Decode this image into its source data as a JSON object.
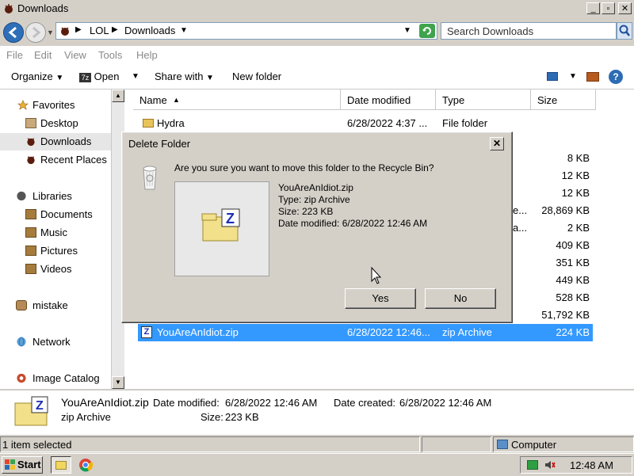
{
  "window": {
    "title": "Downloads"
  },
  "address": {
    "crumbs": [
      "LOL",
      "Downloads"
    ],
    "search_placeholder": "Search Downloads"
  },
  "menu": [
    "File",
    "Edit",
    "View",
    "Tools",
    "Help"
  ],
  "toolbar": {
    "organize": "Organize",
    "open": "Open",
    "share_with": "Share with",
    "new_folder": "New folder"
  },
  "nav": {
    "favorites": "Favorites",
    "desktop": "Desktop",
    "downloads": "Downloads",
    "recent_places": "Recent Places",
    "libraries": "Libraries",
    "documents": "Documents",
    "music": "Music",
    "pictures": "Pictures",
    "videos": "Videos",
    "mistake": "mistake",
    "network": "Network",
    "image_catalog": "Image Catalog"
  },
  "columns": {
    "name": "Name",
    "date": "Date modified",
    "type": "Type",
    "size": "Size"
  },
  "rows": {
    "hydra": {
      "name": "Hydra",
      "date": "6/28/2022 4:37 ...",
      "type": "File folder",
      "size": ""
    },
    "sizes": [
      "8 KB",
      "12 KB",
      "12 KB",
      "28,869 KB",
      "2 KB",
      "409 KB",
      "351 KB",
      "449 KB",
      "528 KB",
      "51,792 KB"
    ],
    "partial_e": "e...",
    "partial_a": "a...",
    "selected": {
      "name": "YouAreAnIdiot.zip",
      "date": "6/28/2022 12:46...",
      "type": "zip Archive",
      "size": "224 KB"
    }
  },
  "details": {
    "name": "YouAreAnIdiot.zip",
    "type": "zip Archive",
    "date_modified_label": "Date modified:",
    "date_modified": "6/28/2022 12:46 AM",
    "date_created_label": "Date created:",
    "date_created": "6/28/2022 12:46 AM",
    "size_label": "Size:",
    "size": "223 KB"
  },
  "status": {
    "selected": "1 item selected",
    "location": "Computer"
  },
  "taskbar": {
    "start": "Start",
    "clock": "12:48 AM"
  },
  "dialog": {
    "title": "Delete Folder",
    "question": "Are you sure you want to move this folder to the Recycle Bin?",
    "file_name": "YouAreAnIdiot.zip",
    "file_type": "Type: zip Archive",
    "file_size": "Size: 223 KB",
    "file_date": "Date modified: 6/28/2022 12:46 AM",
    "yes": "Yes",
    "no": "No",
    "close": "✕"
  },
  "icons": [
    "back-icon",
    "forward-icon",
    "folder-icon",
    "search-icon",
    "star-icon",
    "library-icon",
    "network-icon",
    "zip-icon",
    "recycle-bin-icon",
    "help-icon",
    "computer-icon",
    "chrome-icon"
  ]
}
